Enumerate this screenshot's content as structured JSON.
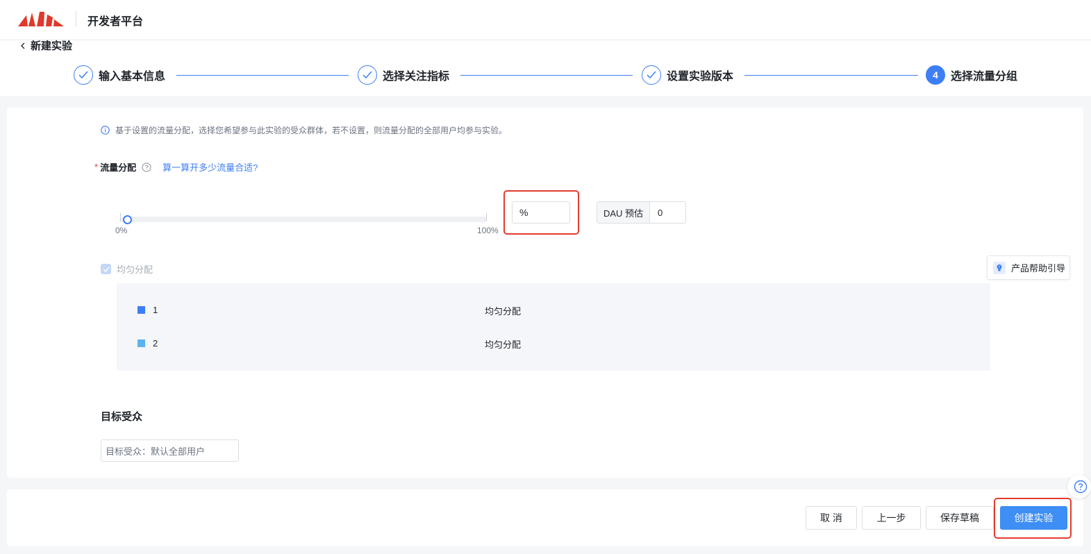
{
  "header": {
    "title": "开发者平台",
    "logo_icon": "logo-icon"
  },
  "nav": {
    "back_label": "新建实验"
  },
  "steps": [
    {
      "label": "输入基本信息",
      "status": "done"
    },
    {
      "label": "选择关注指标",
      "status": "done"
    },
    {
      "label": "设置实验版本",
      "status": "done"
    },
    {
      "label": "选择流量分组",
      "status": "active",
      "number": "4"
    }
  ],
  "traffic": {
    "notice": "基于设置的流量分配，选择您希望参与此实验的受众群体，若不设置，则流量分配的全部用户均参与实验。",
    "required_mark": "*",
    "label": "流量分配",
    "calc_link": "算一算开多少流量合适?",
    "slider": {
      "min_label": "0%",
      "max_label": "100%",
      "value": 0
    },
    "percent_input": "%",
    "dau_label": "DAU 预估",
    "dau_value": "0",
    "even_label": "均匀分配",
    "even_checked": true
  },
  "help_guide": {
    "label": "产品帮助引导"
  },
  "groups": [
    {
      "name": "1",
      "allocation": "均匀分配",
      "color": "#3d7ef5"
    },
    {
      "name": "2",
      "allocation": "均匀分配",
      "color": "#5ab4ee"
    }
  ],
  "audience": {
    "title": "目标受众",
    "placeholder": "目标受众：默认全部用户"
  },
  "footer": {
    "cancel": "取 消",
    "prev": "上一步",
    "save_draft": "保存草稿",
    "create": "创建实验"
  },
  "colors": {
    "accent": "#3d7ef5",
    "highlight": "#e23b2e",
    "brand": "#e0382b"
  }
}
